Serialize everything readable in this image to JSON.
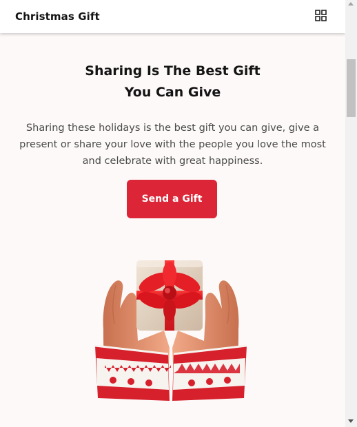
{
  "header": {
    "brand": "Christmas Gift",
    "menu_icon": "grid-icon"
  },
  "hero": {
    "title_line1": "Sharing Is The Best Gift",
    "title_line2": "You Can Give",
    "description": "Sharing these holidays is the best gift you can give, give a present or share your love with the people you love the most and celebrate with great happiness.",
    "cta_label": "Send a Gift"
  },
  "illustration": {
    "icon": "hands-holding-gift-illustration"
  },
  "colors": {
    "accent": "#dc2537",
    "background": "#fdf9f8",
    "sweater_red": "#d6202c"
  }
}
